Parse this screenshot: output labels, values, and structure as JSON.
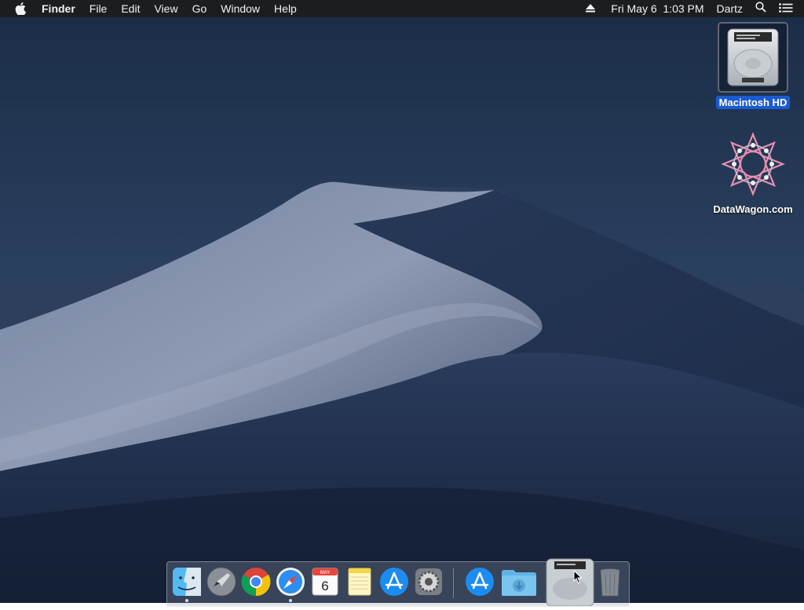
{
  "menubar": {
    "app_name": "Finder",
    "menus": [
      "File",
      "Edit",
      "View",
      "Go",
      "Window",
      "Help"
    ],
    "datetime": "Fri May 6  1:03 PM",
    "user": "Dartz",
    "icons": [
      "apple-icon",
      "eject-icon",
      "spotlight-icon",
      "notification-center-icon"
    ]
  },
  "desktop": {
    "icons": [
      {
        "label": "Macintosh HD",
        "icon": "hard-drive-icon",
        "selected": true
      },
      {
        "label": "DataWagon.com",
        "icon": "datawagon-logo-icon",
        "selected": false
      }
    ]
  },
  "dock": {
    "apps": [
      {
        "name": "finder",
        "running": true
      },
      {
        "name": "launchpad",
        "running": false
      },
      {
        "name": "chrome",
        "running": false
      },
      {
        "name": "safari",
        "running": true
      },
      {
        "name": "calendar",
        "running": false,
        "month": "MAY",
        "day": "6"
      },
      {
        "name": "notes",
        "running": false
      },
      {
        "name": "app-store",
        "running": false
      },
      {
        "name": "system-preferences",
        "running": false
      },
      {
        "name": "app-store-download",
        "running": false
      },
      {
        "name": "downloads-folder",
        "running": false
      },
      {
        "name": "macintosh-hd-drag",
        "running": false
      },
      {
        "name": "trash",
        "running": false
      }
    ]
  },
  "colors": {
    "sky": "#1e3350",
    "dune_light": "#8793ab",
    "selection": "#1b5ad1"
  }
}
